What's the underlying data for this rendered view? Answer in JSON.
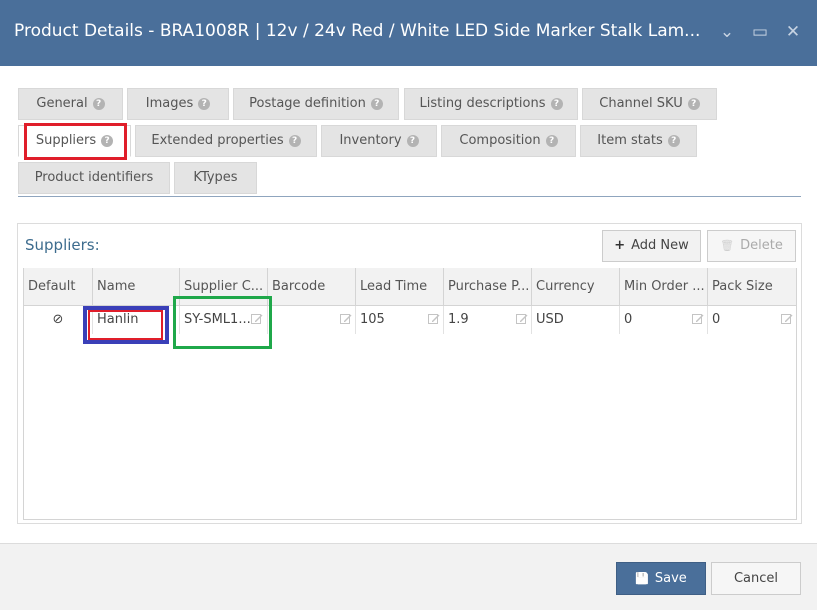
{
  "window": {
    "title": "Product Details - BRA1008R | 12v / 24v Red / White LED Side Marker Stalk Lam...",
    "controls": {
      "minimize": "⌄",
      "maximize": "▭",
      "close": "✕"
    }
  },
  "tabs": [
    {
      "label": "General",
      "help": "?"
    },
    {
      "label": "Images",
      "help": "?"
    },
    {
      "label": "Postage definition",
      "help": "?"
    },
    {
      "label": "Listing descriptions",
      "help": "?"
    },
    {
      "label": "Channel SKU",
      "help": "?"
    },
    {
      "label": "Suppliers",
      "help": "?",
      "active": true
    },
    {
      "label": "Extended properties",
      "help": "?"
    },
    {
      "label": "Inventory",
      "help": "?"
    },
    {
      "label": "Composition",
      "help": "?"
    },
    {
      "label": "Item stats",
      "help": "?"
    },
    {
      "label": "Product identifiers"
    },
    {
      "label": "KTypes"
    }
  ],
  "suppliers": {
    "title": "Suppliers:",
    "add_new": {
      "icon": "+",
      "label": "Add New"
    },
    "delete": {
      "icon": "🗑",
      "label": "Delete"
    },
    "columns": [
      "Default",
      "Name",
      "Supplier C...",
      "Barcode",
      "Lead Time",
      "Purchase P...",
      "Currency",
      "Min Order ...",
      "Pack Size"
    ],
    "rows": [
      {
        "default": "⊘",
        "name": "Hanlin",
        "supplier_code": "SY-SML1...",
        "barcode": "",
        "lead_time": "105",
        "purchase_price": "1.9",
        "currency": "USD",
        "min_order": "0",
        "pack_size": "0"
      }
    ]
  },
  "footer": {
    "save": {
      "icon": "💾",
      "label": "Save"
    },
    "cancel": {
      "label": "Cancel"
    }
  },
  "colors": {
    "titlebar": "#4a6f9a",
    "highlight_red": "#e01e2a",
    "highlight_blue": "#3a3fb8",
    "highlight_green": "#1fa84a"
  }
}
